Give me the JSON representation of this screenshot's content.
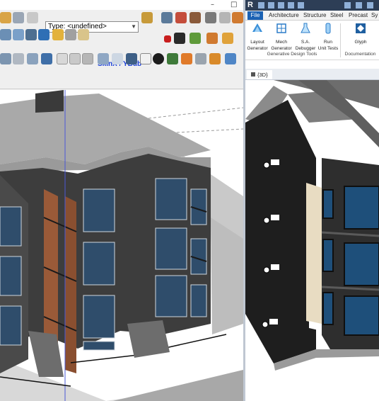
{
  "left_window": {
    "controls": {
      "minimize": "–",
      "maximize": "□"
    },
    "type_select": {
      "value": "Type: <undefined>"
    },
    "skin_label": "SkinX / YBub"
  },
  "right_window": {
    "ribbon_tabs": [
      "File",
      "Architecture",
      "Structure",
      "Steel",
      "Precast",
      "Sy"
    ],
    "buttons": [
      {
        "line1": "Layout",
        "line2": "Generator",
        "icon": "layout-generator-icon"
      },
      {
        "line1": "Mech",
        "line2": "Generator",
        "icon": "mech-generator-icon"
      },
      {
        "line1": "S.A.",
        "line2": "Debugger",
        "icon": "flask-icon"
      },
      {
        "line1": "Run",
        "line2": "Unit Tests",
        "icon": "run-tests-icon"
      },
      {
        "line1": "Glyph",
        "line2": "",
        "icon": "glyph-icon"
      }
    ],
    "panel_titles": [
      "Generative Design Tools",
      "Documentation"
    ],
    "view_tab": "{3D}"
  },
  "colors": {
    "revit_titlebar": "#2d3e56",
    "file_tab": "#1b62b4",
    "brick": "#3c3c3c",
    "window_glass": "#1d4a73",
    "wood_panel": "#9a5a38"
  }
}
